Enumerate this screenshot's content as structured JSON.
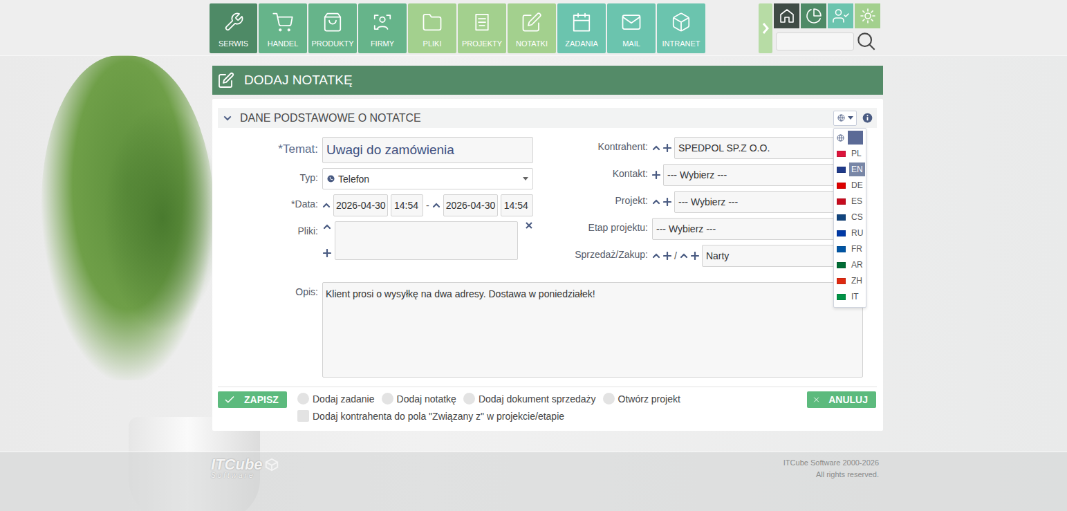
{
  "nav": [
    {
      "label": "SERWIS",
      "color": "#4e8a66"
    },
    {
      "label": "HANDEL",
      "color": "#66b48a"
    },
    {
      "label": "PRODUKTY",
      "color": "#66b48a"
    },
    {
      "label": "FIRMY",
      "color": "#66b48a"
    },
    {
      "label": "PLIKI",
      "color": "#a3d08e"
    },
    {
      "label": "PROJEKTY",
      "color": "#a3d08e"
    },
    {
      "label": "NOTATKI",
      "color": "#a3d08e"
    },
    {
      "label": "ZADANIA",
      "color": "#6bc4ae"
    },
    {
      "label": "MAIL",
      "color": "#6bc4ae"
    },
    {
      "label": "INTRANET",
      "color": "#6bc4ae"
    }
  ],
  "page": {
    "title": "DODAJ NOTATKĘ"
  },
  "section": {
    "title": "DANE PODSTAWOWE O NOTATCE",
    "expanded": true
  },
  "language_menu": {
    "open": true,
    "items": [
      {
        "kind": "all",
        "label": "",
        "selected": false,
        "color": "#5b6a96"
      },
      {
        "kind": "flag",
        "label": "PL",
        "selected": false,
        "color": "#dc143c"
      },
      {
        "kind": "flag",
        "label": "EN",
        "selected": true,
        "color": "#1f3a8a"
      },
      {
        "kind": "flag",
        "label": "DE",
        "selected": false,
        "color": "#dd0000"
      },
      {
        "kind": "flag",
        "label": "ES",
        "selected": false,
        "color": "#c60b1e"
      },
      {
        "kind": "flag",
        "label": "CS",
        "selected": false,
        "color": "#11457e"
      },
      {
        "kind": "flag",
        "label": "RU",
        "selected": false,
        "color": "#0039a6"
      },
      {
        "kind": "flag",
        "label": "FR",
        "selected": false,
        "color": "#0055a4"
      },
      {
        "kind": "flag",
        "label": "AR",
        "selected": false,
        "color": "#006c35"
      },
      {
        "kind": "flag",
        "label": "ZH",
        "selected": false,
        "color": "#de2910"
      },
      {
        "kind": "flag",
        "label": "IT",
        "selected": false,
        "color": "#009246"
      }
    ]
  },
  "form": {
    "subject": {
      "label": "*Temat:",
      "value": "Uwagi do zamówienia"
    },
    "type": {
      "label": "Typ:",
      "value": "Telefon"
    },
    "date": {
      "label": "*Data:",
      "start_date": "2026-04-30",
      "start_time": "14:54",
      "separator": "-",
      "end_date": "2026-04-30",
      "end_time": "14:54"
    },
    "files": {
      "label": "Pliki:"
    },
    "right": [
      {
        "label": "Kontrahent:",
        "kind": "lookup",
        "value": "SPEDPOL SP.Z O.O.",
        "separator": ""
      },
      {
        "label": "Kontakt:",
        "kind": "add",
        "value": "--- Wybierz ---",
        "separator": ""
      },
      {
        "label": "Projekt:",
        "kind": "lookup",
        "value": "--- Wybierz ---",
        "separator": ""
      },
      {
        "label": "Etap projektu:",
        "kind": "select",
        "value": "--- Wybierz ---",
        "separator": ""
      },
      {
        "label": "Sprzedaż/Zakup:",
        "kind": "dual",
        "value": "Narty",
        "separator": "/"
      }
    ],
    "description": {
      "label": "Opis:",
      "value": "Klient prosi o wysyłkę na dwa adresy. Dostawa w poniedziałek!"
    }
  },
  "actions": {
    "save": "ZAPISZ",
    "cancel": "ANULUJ",
    "options": [
      {
        "label": "Dodaj zadanie",
        "selected": false
      },
      {
        "label": "Dodaj notatkę",
        "selected": false
      },
      {
        "label": "Dodaj dokument sprzedaży",
        "selected": false
      },
      {
        "label": "Otwórz projekt",
        "selected": false
      }
    ],
    "checkbox": {
      "label": "Dodaj kontrahenta do pola \"Związany z\" w projekcie/etapie",
      "checked": false
    }
  },
  "footer": {
    "logo": "ITCube",
    "logo_sub": "Software",
    "copyright": "ITCube Software 2000-2026",
    "rights": "All rights reserved."
  }
}
